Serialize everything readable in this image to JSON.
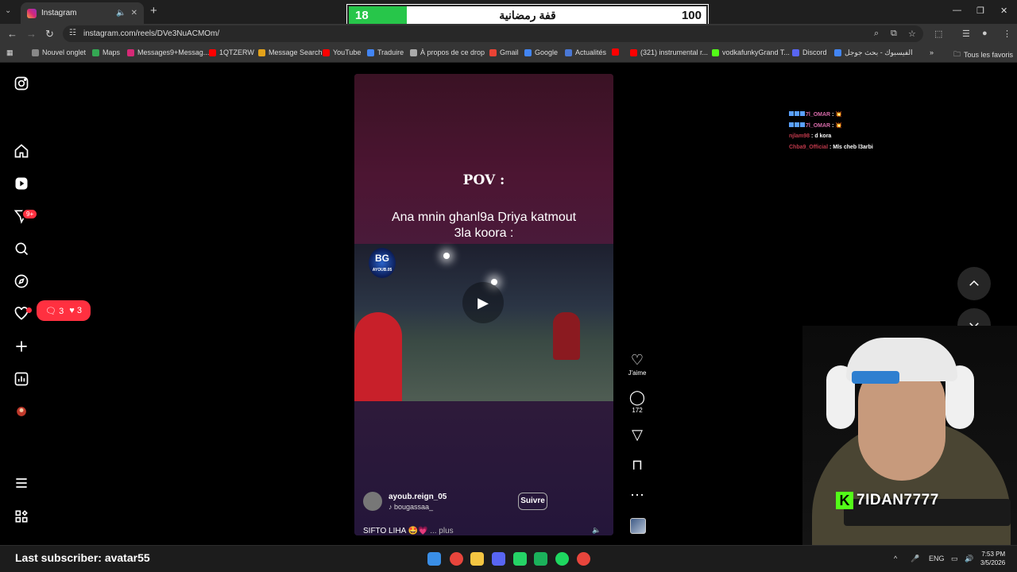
{
  "browser": {
    "tab_title": "Instagram",
    "url": "instagram.com/reels/DVe3NuACMOm/",
    "bookmarks": [
      {
        "label": "Nouvel onglet",
        "color": "#888888"
      },
      {
        "label": "Maps",
        "color": "#34a853"
      },
      {
        "label": "Messages9+Messag...",
        "color": "#d62976"
      },
      {
        "label": "1QTZERW",
        "color": "#ff0000"
      },
      {
        "label": "Message Search",
        "color": "#e3a21a"
      },
      {
        "label": "YouTube",
        "color": "#ff0000"
      },
      {
        "label": "Traduire",
        "color": "#4285f4"
      },
      {
        "label": "À propos de ce drop",
        "color": "#aaaaaa"
      },
      {
        "label": "Gmail",
        "color": "#ea4335"
      },
      {
        "label": "Google",
        "color": "#4285f4"
      },
      {
        "label": "Actualités",
        "color": "#4a78d6"
      },
      {
        "label": "",
        "color": "#ff0000"
      },
      {
        "label": "(321) instrumental r...",
        "color": "#ff0000"
      },
      {
        "label": "vodkafunkyGrand T...",
        "color": "#53fc18"
      },
      {
        "label": "Discord",
        "color": "#5865f2"
      },
      {
        "label": "الفيسبوك - بحث جوجل",
        "color": "#4285f4"
      }
    ],
    "all_bookmarks": "Tous les favoris"
  },
  "score_overlay": {
    "current": "18",
    "title": "قفة رمضانية",
    "max": "100",
    "progress": 0.18
  },
  "sidebar": {
    "badge": "9+",
    "notif_comments": "3",
    "notif_likes": "3"
  },
  "reel": {
    "pov_text": "POV :",
    "caption_line1": "Ana mnin ghanl9a Ḍriya katmout",
    "caption_line2": "3la koora :",
    "logo_text": "BG",
    "logo_sub": "AYOUB.05",
    "username": "ayoub.reign_05",
    "audio": "bougassaa_",
    "follow_label": "Suivre",
    "description": "SIFTO LIHA 🤩💗",
    "more_label": "... plus"
  },
  "actions": {
    "like_label": "J'aime",
    "comment_count": "172"
  },
  "chat": [
    {
      "user": "7l_OMAR",
      "message": "💥",
      "style": "u1",
      "badges": true
    },
    {
      "user": "7l_OMAR",
      "message": "💥",
      "style": "u1",
      "badges": true
    },
    {
      "user": "njlam98",
      "message": "d kora",
      "style": "u2",
      "badges": false
    },
    {
      "user": "Chba9_Official",
      "message": "Mls cheb l3arbi",
      "style": "u2",
      "badges": false
    }
  ],
  "streamer": {
    "name": "7IDAN7777",
    "last_subscriber": "Last subscriber: avatar55"
  },
  "taskbar": {
    "lang": "ENG",
    "time": "7:53 PM",
    "date": "3/5/2026"
  }
}
